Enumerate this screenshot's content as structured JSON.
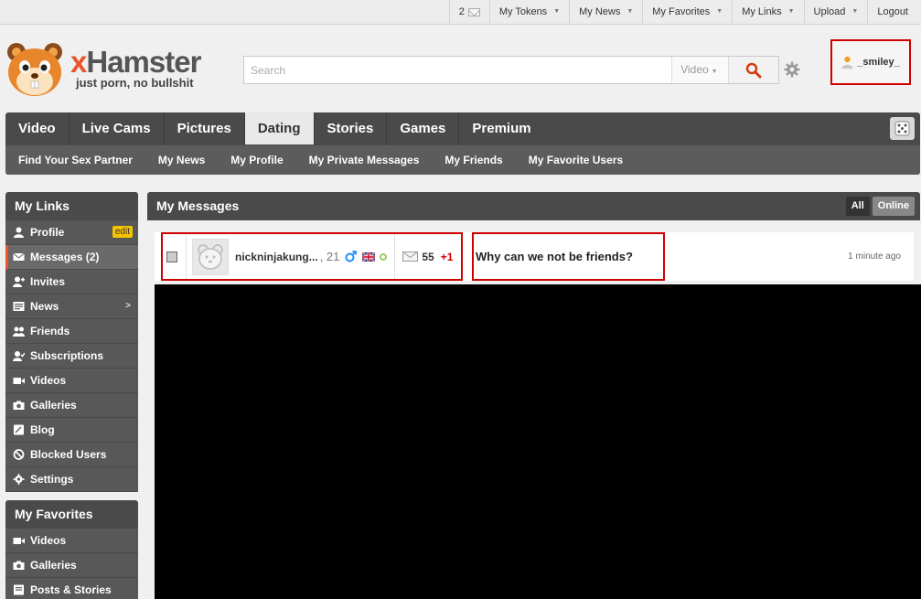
{
  "topbar": {
    "message_count": "2",
    "links": [
      "My Tokens",
      "My News",
      "My Favorites",
      "My Links",
      "Upload"
    ],
    "logout": "Logout"
  },
  "brand": {
    "name_x": "x",
    "name_rest": "Hamster",
    "tagline": "just porn, no bullshit",
    "accent_color": "#e8542c"
  },
  "search": {
    "placeholder": "Search",
    "type": "Video"
  },
  "user": {
    "name": "_smiley_"
  },
  "nav": {
    "tabs": [
      "Video",
      "Live Cams",
      "Pictures",
      "Dating",
      "Stories",
      "Games",
      "Premium"
    ],
    "active_tab": "Dating",
    "subnav": [
      "Find Your Sex Partner",
      "My News",
      "My Profile",
      "My Private Messages",
      "My Friends",
      "My Favorite Users"
    ]
  },
  "sidebar": {
    "links_title": "My Links",
    "links": [
      {
        "label": "Profile",
        "icon": "user-icon",
        "edit": "edit"
      },
      {
        "label": "Messages (2)",
        "icon": "envelope-icon",
        "active": true
      },
      {
        "label": "Invites",
        "icon": "invite-icon"
      },
      {
        "label": "News",
        "icon": "news-icon",
        "arrow": ">"
      },
      {
        "label": "Friends",
        "icon": "friends-icon"
      },
      {
        "label": "Subscriptions",
        "icon": "subscriptions-icon"
      },
      {
        "label": "Videos",
        "icon": "video-icon"
      },
      {
        "label": "Galleries",
        "icon": "camera-icon"
      },
      {
        "label": "Blog",
        "icon": "blog-icon"
      },
      {
        "label": "Blocked Users",
        "icon": "blocked-icon"
      },
      {
        "label": "Settings",
        "icon": "gear-icon"
      }
    ],
    "favorites_title": "My Favorites",
    "favorites": [
      {
        "label": "Videos",
        "icon": "video-icon"
      },
      {
        "label": "Galleries",
        "icon": "camera-icon"
      },
      {
        "label": "Posts & Stories",
        "icon": "posts-icon"
      }
    ]
  },
  "messages": {
    "title": "My Messages",
    "filter_all": "All",
    "filter_online": "Online",
    "row": {
      "username": "nickninjakung...",
      "age": ", 21",
      "count": "55",
      "new": "+1",
      "subject": "Why can we not be friends?",
      "time": "1 minute ago"
    }
  }
}
